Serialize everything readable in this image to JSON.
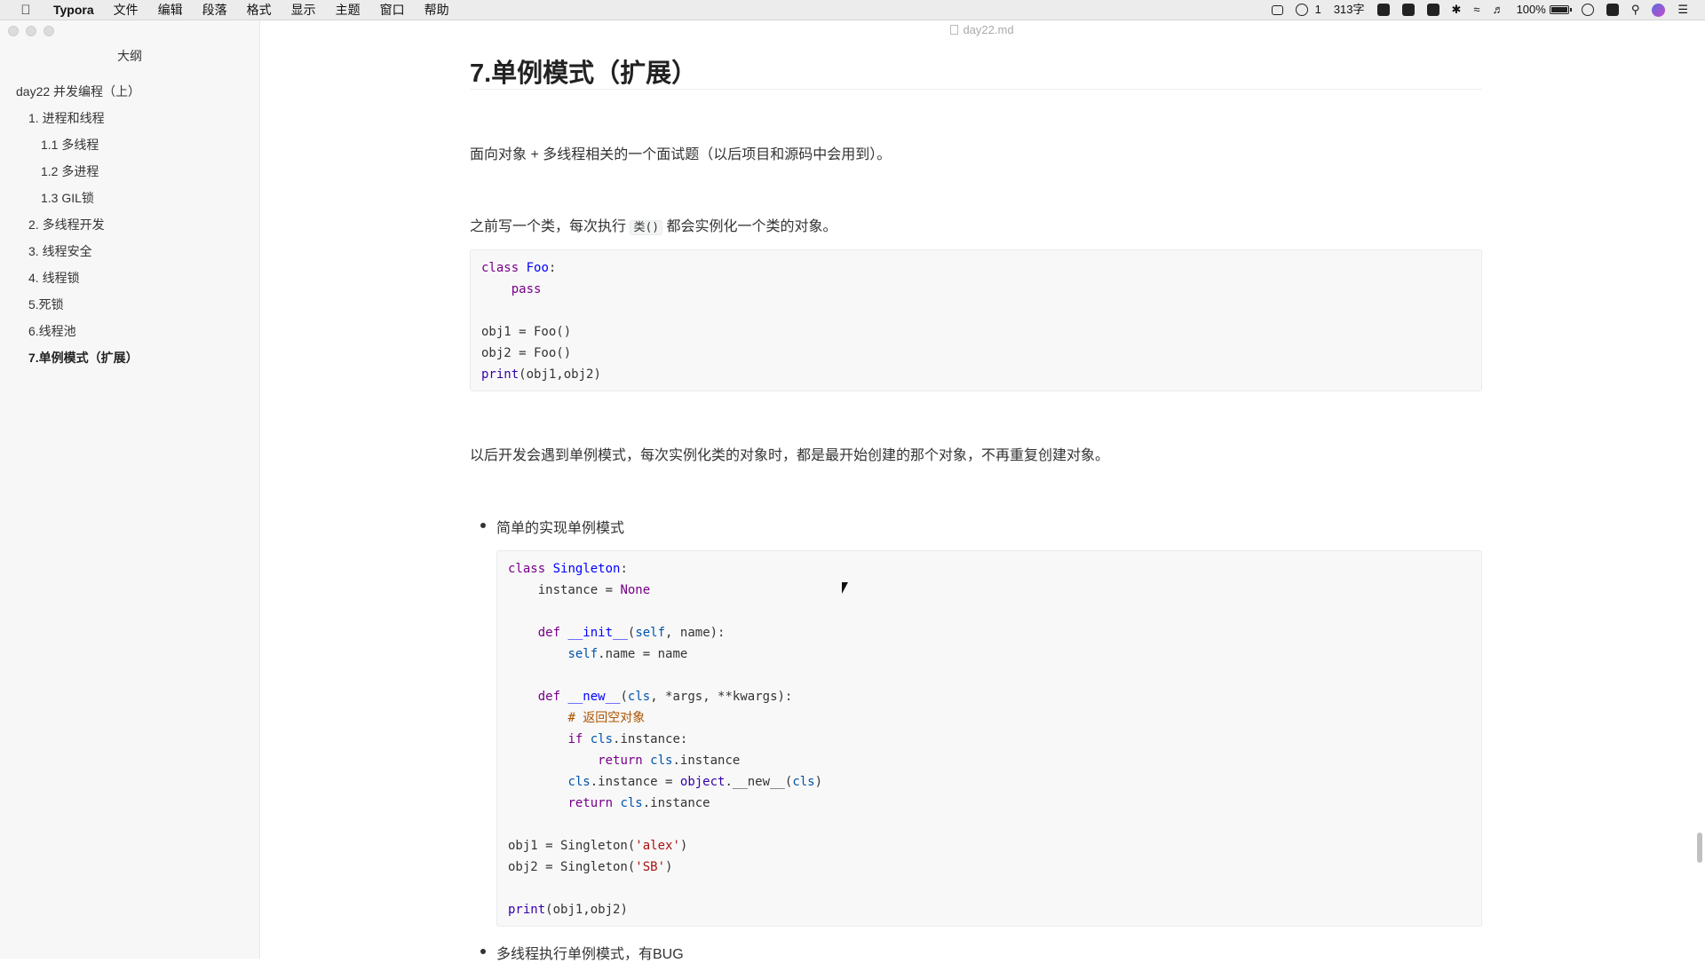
{
  "menubar": {
    "app_name": "Typora",
    "menus": [
      "文件",
      "编辑",
      "段落",
      "格式",
      "显示",
      "主题",
      "窗口",
      "帮助"
    ],
    "status": {
      "wechat_count": "1",
      "word_count": "313字",
      "battery": "100%"
    }
  },
  "window": {
    "filename": "day22.md"
  },
  "sidebar": {
    "title": "大纲",
    "items": [
      {
        "label": "day22 并发编程（上）",
        "level": 1
      },
      {
        "label": "1. 进程和线程",
        "level": 2
      },
      {
        "label": "1.1 多线程",
        "level": 3
      },
      {
        "label": "1.2 多进程",
        "level": 3
      },
      {
        "label": "1.3 GIL锁",
        "level": 3
      },
      {
        "label": "2. 多线程开发",
        "level": 2
      },
      {
        "label": "3. 线程安全",
        "level": 2
      },
      {
        "label": "4. 线程锁",
        "level": 2
      },
      {
        "label": "5.死锁",
        "level": 2
      },
      {
        "label": "6.线程池",
        "level": 2
      },
      {
        "label": "7.单例模式（扩展）",
        "level": 2,
        "active": true
      }
    ]
  },
  "doc": {
    "heading": "7.单例模式（扩展）",
    "para1": "面向对象 + 多线程相关的一个面试题（以后项目和源码中会用到）。",
    "para2_before": "之前写一个类，每次执行 ",
    "para2_code": "类()",
    "para2_after": " 都会实例化一个类的对象。",
    "para3": "以后开发会遇到单例模式，每次实例化类的对象时，都是最开始创建的那个对象，不再重复创建对象。",
    "bullet1": "简单的实现单例模式",
    "bullet2": "多线程执行单例模式，有BUG",
    "code1": "class Foo:\n    pass\n\nobj1 = Foo()\nobj2 = Foo()\nprint(obj1,obj2)",
    "code2": "class Singleton:\n    instance = None\n\n    def __init__(self, name):\n        self.name = name\n\n    def __new__(cls, *args, **kwargs):\n        # 返回空对象\n        if cls.instance:\n            return cls.instance\n        cls.instance = object.__new__(cls)\n        return cls.instance\n\nobj1 = Singleton('alex')\nobj2 = Singleton('SB')\n\nprint(obj1,obj2)"
  }
}
